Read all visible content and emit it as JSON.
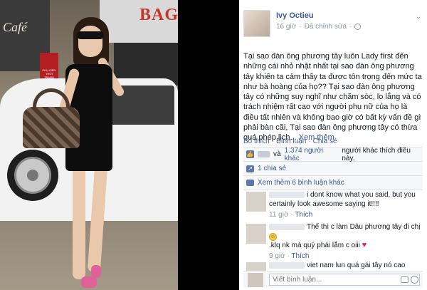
{
  "post": {
    "author": "Ivy Octieu",
    "time": "16 giờ",
    "edited": "Đã chỉnh sửa",
    "body": "Tại sao đàn ông phương tây luôn Lady first đến những cái nhỏ nhặt nhất tại sao đàn ông phương tây khiến ta cảm thấy ta được tôn trọng đến mức ta như bà hoàng của họ?? Tại sao đàn ông phương tây có những suy nghĩ như chăm sóc, lo lắng và có trách nhiệm rất cao với người phụ nữ của họ là điều tất nhiên và không bao giờ có bất kỳ vấn đề gì phải bàn cãi, Tại sao đàn ông phương tây có thừa quá phép lịch...",
    "see_more": "Xem thêm"
  },
  "actions": {
    "like": "Bỏ thích",
    "comment": "Bình luận",
    "share": "Chia sẻ"
  },
  "feedback": {
    "likes_prefix": "và",
    "likes_link": "1.374 người khác",
    "likes_suffix": "người khác thích điều này.",
    "shares": "1 chia sẻ",
    "more_comments": "Xem thêm 6 bình luận khác"
  },
  "comments": [
    {
      "text": "i dont know what you said, but you certainly look awesome saying it!!!!",
      "time": "11 giờ",
      "like": "Thích"
    },
    {
      "text": "Thế thì c làm Dâu phương tây đi chị",
      "text2": ".klq nk mà quý phái lắm c oiii",
      "time": "9 giờ",
      "like": "Thích"
    },
    {
      "text": "viet nam lun quá gái tây nó cao"
    }
  ],
  "write_comment": {
    "placeholder": "Viết bình luận..."
  },
  "photo": {
    "cafe_sign": "Café",
    "store_sign": "BAG",
    "banner": "PHỤ KIỆN THỜI TRANG"
  },
  "icons": {
    "avatar": "profile-photo",
    "globe": "globe-icon",
    "chevron": "chevron-down-icon",
    "like": "thumbs-up-icon",
    "share": "share-icon",
    "comment": "comment-icon",
    "camera": "camera-icon",
    "emoji": "emoji-icon"
  },
  "colors": {
    "link": "#3b5998",
    "meta": "#9197a3",
    "feedback_bg": "#f6f7f8"
  }
}
